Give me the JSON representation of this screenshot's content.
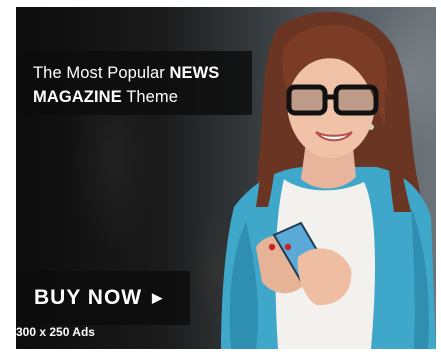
{
  "ad": {
    "headline_line1_prefix": "The Most Popular",
    "headline_line1_bold": "NEWS",
    "headline_line2_bold": "MAGAZINE",
    "headline_line2_suffix": "Theme",
    "cta_label": "BUY NOW",
    "cta_icon": "chevron-right-icon",
    "size_note": "300 x 250 Ads"
  },
  "colors": {
    "overlay": "#0c0c0c",
    "text": "#ffffff",
    "cardigan": "#3fa7c9"
  }
}
